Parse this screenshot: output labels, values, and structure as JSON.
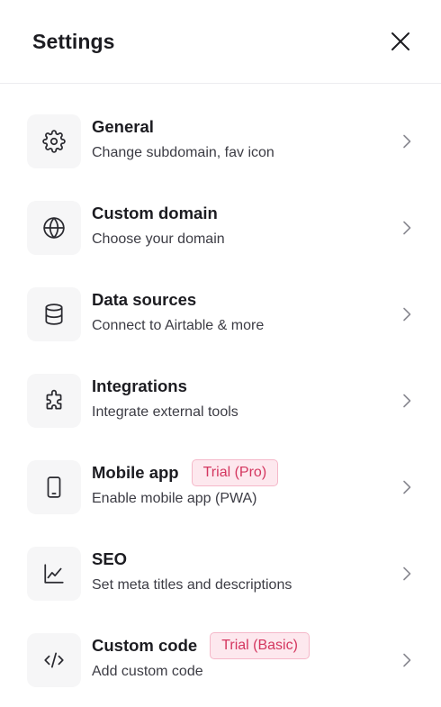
{
  "header": {
    "title": "Settings"
  },
  "items": [
    {
      "label": "General",
      "desc": "Change subdomain, fav icon",
      "badge": "",
      "icon": "gear-icon"
    },
    {
      "label": "Custom domain",
      "desc": "Choose your domain",
      "badge": "",
      "icon": "globe-icon"
    },
    {
      "label": "Data sources",
      "desc": "Connect to Airtable & more",
      "badge": "",
      "icon": "database-icon"
    },
    {
      "label": "Integrations",
      "desc": "Integrate external tools",
      "badge": "",
      "icon": "puzzle-icon"
    },
    {
      "label": "Mobile app",
      "desc": "Enable mobile app (PWA)",
      "badge": "Trial (Pro)",
      "icon": "smartphone-icon"
    },
    {
      "label": "SEO",
      "desc": "Set meta titles and descriptions",
      "badge": "",
      "icon": "chart-line-icon"
    },
    {
      "label": "Custom code",
      "desc": "Add custom code",
      "badge": "Trial (Basic)",
      "icon": "code-icon"
    }
  ],
  "colors": {
    "badge_text": "#d4365f",
    "badge_bg": "#fde8ee",
    "icon_bg": "#f6f6f7"
  }
}
